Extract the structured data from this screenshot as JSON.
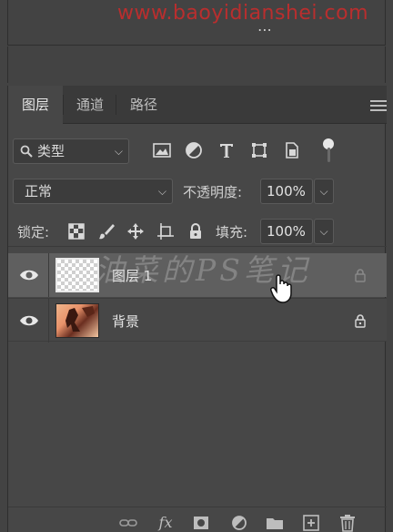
{
  "watermark_url": "www.baoyidianshei.com",
  "watermark_text": "油菜的PS笔记",
  "grip_icon": "⋯",
  "tabs": [
    {
      "label": "图层",
      "active": true
    },
    {
      "label": "通道",
      "active": false
    },
    {
      "label": "路径",
      "active": false
    }
  ],
  "filter": {
    "kind_label": "类型"
  },
  "blend": {
    "mode": "正常",
    "opacity_label": "不透明度:",
    "opacity_value": "100%"
  },
  "lock": {
    "label": "锁定:",
    "fill_label": "填充:",
    "fill_value": "100%"
  },
  "layers": [
    {
      "name": "图层 1",
      "selected": true,
      "visible": true,
      "thumb": "transparent"
    },
    {
      "name": "背景",
      "selected": false,
      "visible": true,
      "thumb": "photo",
      "locked": true
    }
  ],
  "icons": {
    "filter_icons": [
      "image-filter-icon",
      "adjustment-filter-icon",
      "type-filter-icon",
      "shape-filter-icon",
      "smartobject-filter-icon"
    ],
    "lock_icons": [
      "lock-transparent-pixels-icon",
      "lock-image-pixels-icon",
      "lock-position-icon",
      "lock-artboard-icon",
      "lock-all-icon"
    ],
    "bottom_icons": [
      "link-layers-icon",
      "fx-icon",
      "add-mask-icon",
      "new-adjustment-icon",
      "new-group-icon",
      "new-layer-icon",
      "delete-layer-icon"
    ]
  },
  "colors": {
    "background": "#434343",
    "panel": "#474747",
    "selected_row": "#5f5f5f",
    "watermark_red": "#c62c2c"
  }
}
